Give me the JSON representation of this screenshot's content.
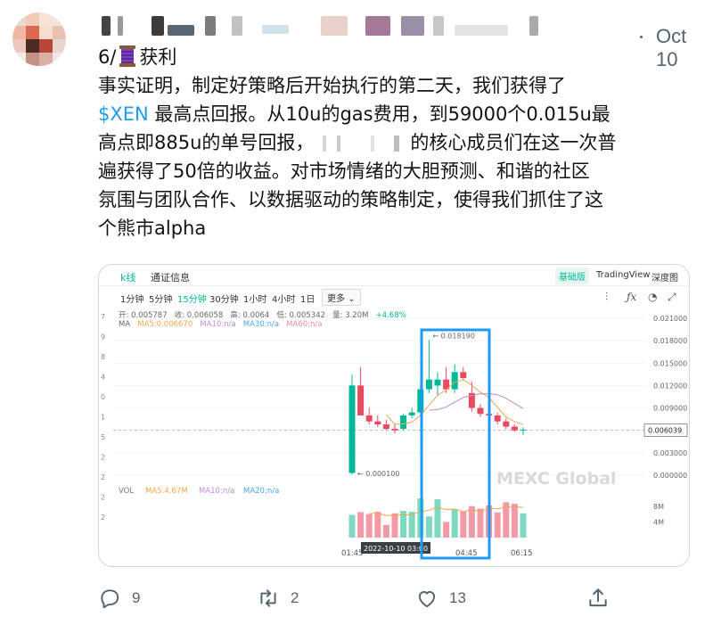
{
  "tweet": {
    "date": "Oct 10",
    "lines": [
      {
        "pre": "6/",
        "post": "获利"
      },
      {
        "text": "事实证明，制定好策略后开始执行的第二天，我们获得了"
      },
      {
        "cashtag": "$XEN",
        "text": " 最高点回报。从10u的gas费用，到59000个0.015u最"
      },
      {
        "pre": "高点即885u的单号回报，",
        "post": "的核心成员们在这一次普"
      },
      {
        "text": "遍获得了50倍的收益。对市场情绪的大胆预测、和谐的社区"
      },
      {
        "text": "氛围与团队合作、以数据驱动的策略制定，使得我们抓住了这"
      },
      {
        "text": "个熊市alpha"
      }
    ]
  },
  "chart": {
    "tabs": [
      "k线",
      "通证信息"
    ],
    "basic_label": "基础版",
    "tradingview_label": "TradingView",
    "depth_label": "深度图",
    "intervals": [
      "1分钟",
      "5分钟",
      "15分钟",
      "30分钟",
      "1小时",
      "4小时",
      "1日"
    ],
    "active_interval": "15分钟",
    "more_label": "更多",
    "ohlc": {
      "open": "开: 0.005787",
      "close": "收: 0.006058",
      "high": "高: 0.0064",
      "low": "低: 0.005342",
      "volume": "量: 3.20M",
      "change": "+4.68%"
    },
    "ma_labels": {
      "ma": "MA",
      "ma5": "MA5:0.006670",
      "ma10": "MA10:n/a",
      "ma30": "MA30:n/a",
      "ma60": "MA60:n/a"
    },
    "vol_labels": {
      "vol": "VOL",
      "ma5": "MA5:4.67M",
      "ma10": "MA10:n/a",
      "ma20": "MA20:n/a"
    },
    "watermark": "MEXC Global",
    "price_axis": [
      "0.021000",
      "0.018000",
      "0.015000",
      "0.012000",
      "0.009000",
      "0.006000",
      "0.003000",
      "0.000000"
    ],
    "current_price": "0.006039",
    "vol_axis": [
      "8M",
      "4M"
    ],
    "high_marker": "0.018190",
    "low_marker": "0.000100",
    "time_labels": [
      "01:45",
      "04:45",
      "06:15"
    ],
    "crosshair_time": "2022-10-10 03:00",
    "left_digits": [
      "7",
      "9",
      "8",
      "4",
      "0",
      "1",
      "5",
      "2",
      "2",
      "2",
      "2"
    ],
    "candles": [
      {
        "o": 0.0003,
        "h": 0.0135,
        "l": 0.0001,
        "c": 0.012
      },
      {
        "o": 0.012,
        "h": 0.0145,
        "l": 0.008,
        "c": 0.008
      },
      {
        "o": 0.008,
        "h": 0.009,
        "l": 0.0068,
        "c": 0.0072
      },
      {
        "o": 0.0072,
        "h": 0.008,
        "l": 0.0064,
        "c": 0.0068
      },
      {
        "o": 0.0068,
        "h": 0.0074,
        "l": 0.006,
        "c": 0.0062
      },
      {
        "o": 0.0062,
        "h": 0.0068,
        "l": 0.0056,
        "c": 0.006
      },
      {
        "o": 0.0062,
        "h": 0.0082,
        "l": 0.006,
        "c": 0.008
      },
      {
        "o": 0.008,
        "h": 0.009,
        "l": 0.0076,
        "c": 0.0084
      },
      {
        "o": 0.0084,
        "h": 0.0122,
        "l": 0.0082,
        "c": 0.0115
      },
      {
        "o": 0.0115,
        "h": 0.0181,
        "l": 0.011,
        "c": 0.0128
      },
      {
        "o": 0.012,
        "h": 0.0138,
        "l": 0.0106,
        "c": 0.0128
      },
      {
        "o": 0.0128,
        "h": 0.0145,
        "l": 0.011,
        "c": 0.0115
      },
      {
        "o": 0.0115,
        "h": 0.0148,
        "l": 0.011,
        "c": 0.0138
      },
      {
        "o": 0.0138,
        "h": 0.0145,
        "l": 0.0128,
        "c": 0.013
      },
      {
        "o": 0.011,
        "h": 0.0125,
        "l": 0.0085,
        "c": 0.009
      },
      {
        "o": 0.009,
        "h": 0.0095,
        "l": 0.0078,
        "c": 0.0082
      },
      {
        "o": 0.0082,
        "h": 0.0088,
        "l": 0.0075,
        "c": 0.008
      },
      {
        "o": 0.008,
        "h": 0.0084,
        "l": 0.0068,
        "c": 0.0072
      },
      {
        "o": 0.0072,
        "h": 0.0076,
        "l": 0.0062,
        "c": 0.0065
      },
      {
        "o": 0.0065,
        "h": 0.0068,
        "l": 0.0058,
        "c": 0.006
      },
      {
        "o": 0.006,
        "h": 0.0064,
        "l": 0.0054,
        "c": 0.0061
      }
    ],
    "volumes": [
      5.8,
      6.5,
      6.0,
      6.6,
      3.2,
      6.2,
      6.8,
      6.6,
      10.0,
      5.4,
      9.8,
      4.0,
      7.2,
      6.6,
      8.0,
      7.4,
      8.2,
      6.4,
      9.0,
      8.6,
      6.2
    ]
  },
  "actions": {
    "reply_count": "9",
    "retweet_count": "2",
    "like_count": "13"
  },
  "colors": {
    "up": "#00b897",
    "down": "#e84a5f",
    "highlight": "#1d9bf0",
    "text_secondary": "#536471"
  }
}
